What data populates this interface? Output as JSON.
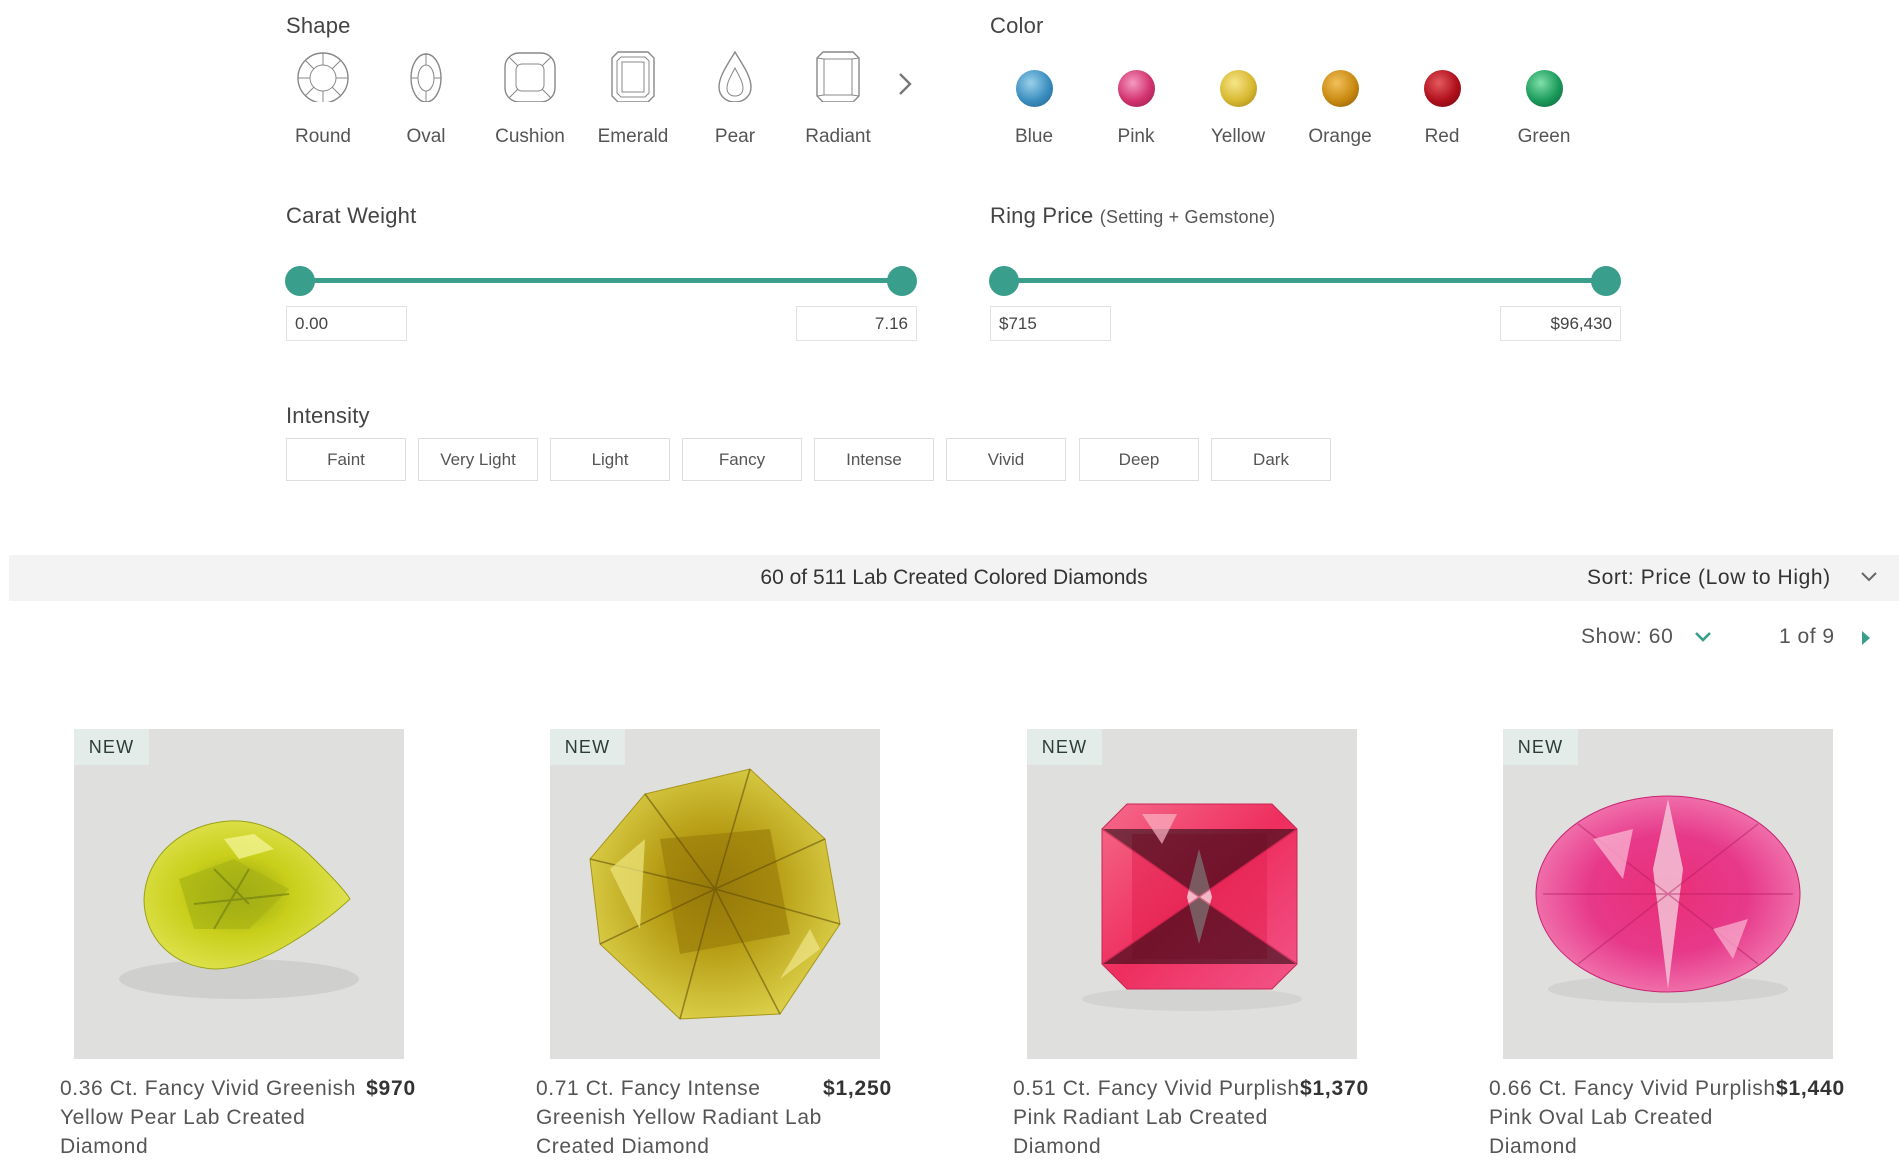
{
  "filters": {
    "shape": {
      "label": "Shape",
      "items": [
        {
          "label": "Round",
          "icon": "round-shape-icon"
        },
        {
          "label": "Oval",
          "icon": "oval-shape-icon"
        },
        {
          "label": "Cushion",
          "icon": "cushion-shape-icon"
        },
        {
          "label": "Emerald",
          "icon": "emerald-shape-icon"
        },
        {
          "label": "Pear",
          "icon": "pear-shape-icon"
        },
        {
          "label": "Radiant",
          "icon": "radiant-shape-icon"
        }
      ],
      "next_icon": "chevron-right-icon"
    },
    "color": {
      "label": "Color",
      "items": [
        {
          "label": "Blue",
          "swatch": "#3b8fc0"
        },
        {
          "label": "Pink",
          "swatch": "#d2336f"
        },
        {
          "label": "Yellow",
          "swatch": "#d9b931"
        },
        {
          "label": "Orange",
          "swatch": "#c98a12"
        },
        {
          "label": "Red",
          "swatch": "#b0101c"
        },
        {
          "label": "Green",
          "swatch": "#1c9a5c"
        }
      ]
    },
    "carat": {
      "label": "Carat Weight",
      "min": "0.00",
      "max": "7.16"
    },
    "price": {
      "label": "Ring Price",
      "sub_label": "(Setting + Gemstone)",
      "min": "$715",
      "max": "$96,430"
    },
    "intensity": {
      "label": "Intensity",
      "options": [
        "Faint",
        "Very Light",
        "Light",
        "Fancy",
        "Intense",
        "Vivid",
        "Deep",
        "Dark"
      ]
    }
  },
  "results": {
    "count_text": "60 of 511 Lab Created Colored Diamonds",
    "sort_text": "Sort: Price (Low to High)",
    "show_text": "Show: 60",
    "paging_text": "1 of 9"
  },
  "accent_color": "#3a9e8c",
  "products": [
    {
      "badge": "NEW",
      "title": "0.36 Ct. Fancy Vivid Greenish Yellow Pear Lab Created Diamond",
      "price": "$970",
      "gem_color": "#c9cf1a"
    },
    {
      "badge": "NEW",
      "title": "0.71 Ct. Fancy Intense Greenish Yellow Radiant Lab Created Diamond",
      "price": "$1,250",
      "gem_color": "#c6b624"
    },
    {
      "badge": "NEW",
      "title": "0.51 Ct. Fancy Vivid Purplish Pink Radiant Lab Created Diamond",
      "price": "$1,370",
      "gem_color": "#ee2e5e"
    },
    {
      "badge": "NEW",
      "title": "0.66 Ct. Fancy Vivid Purplish Pink Oval Lab Created Diamond",
      "price": "$1,440",
      "gem_color": "#e7398a"
    }
  ]
}
